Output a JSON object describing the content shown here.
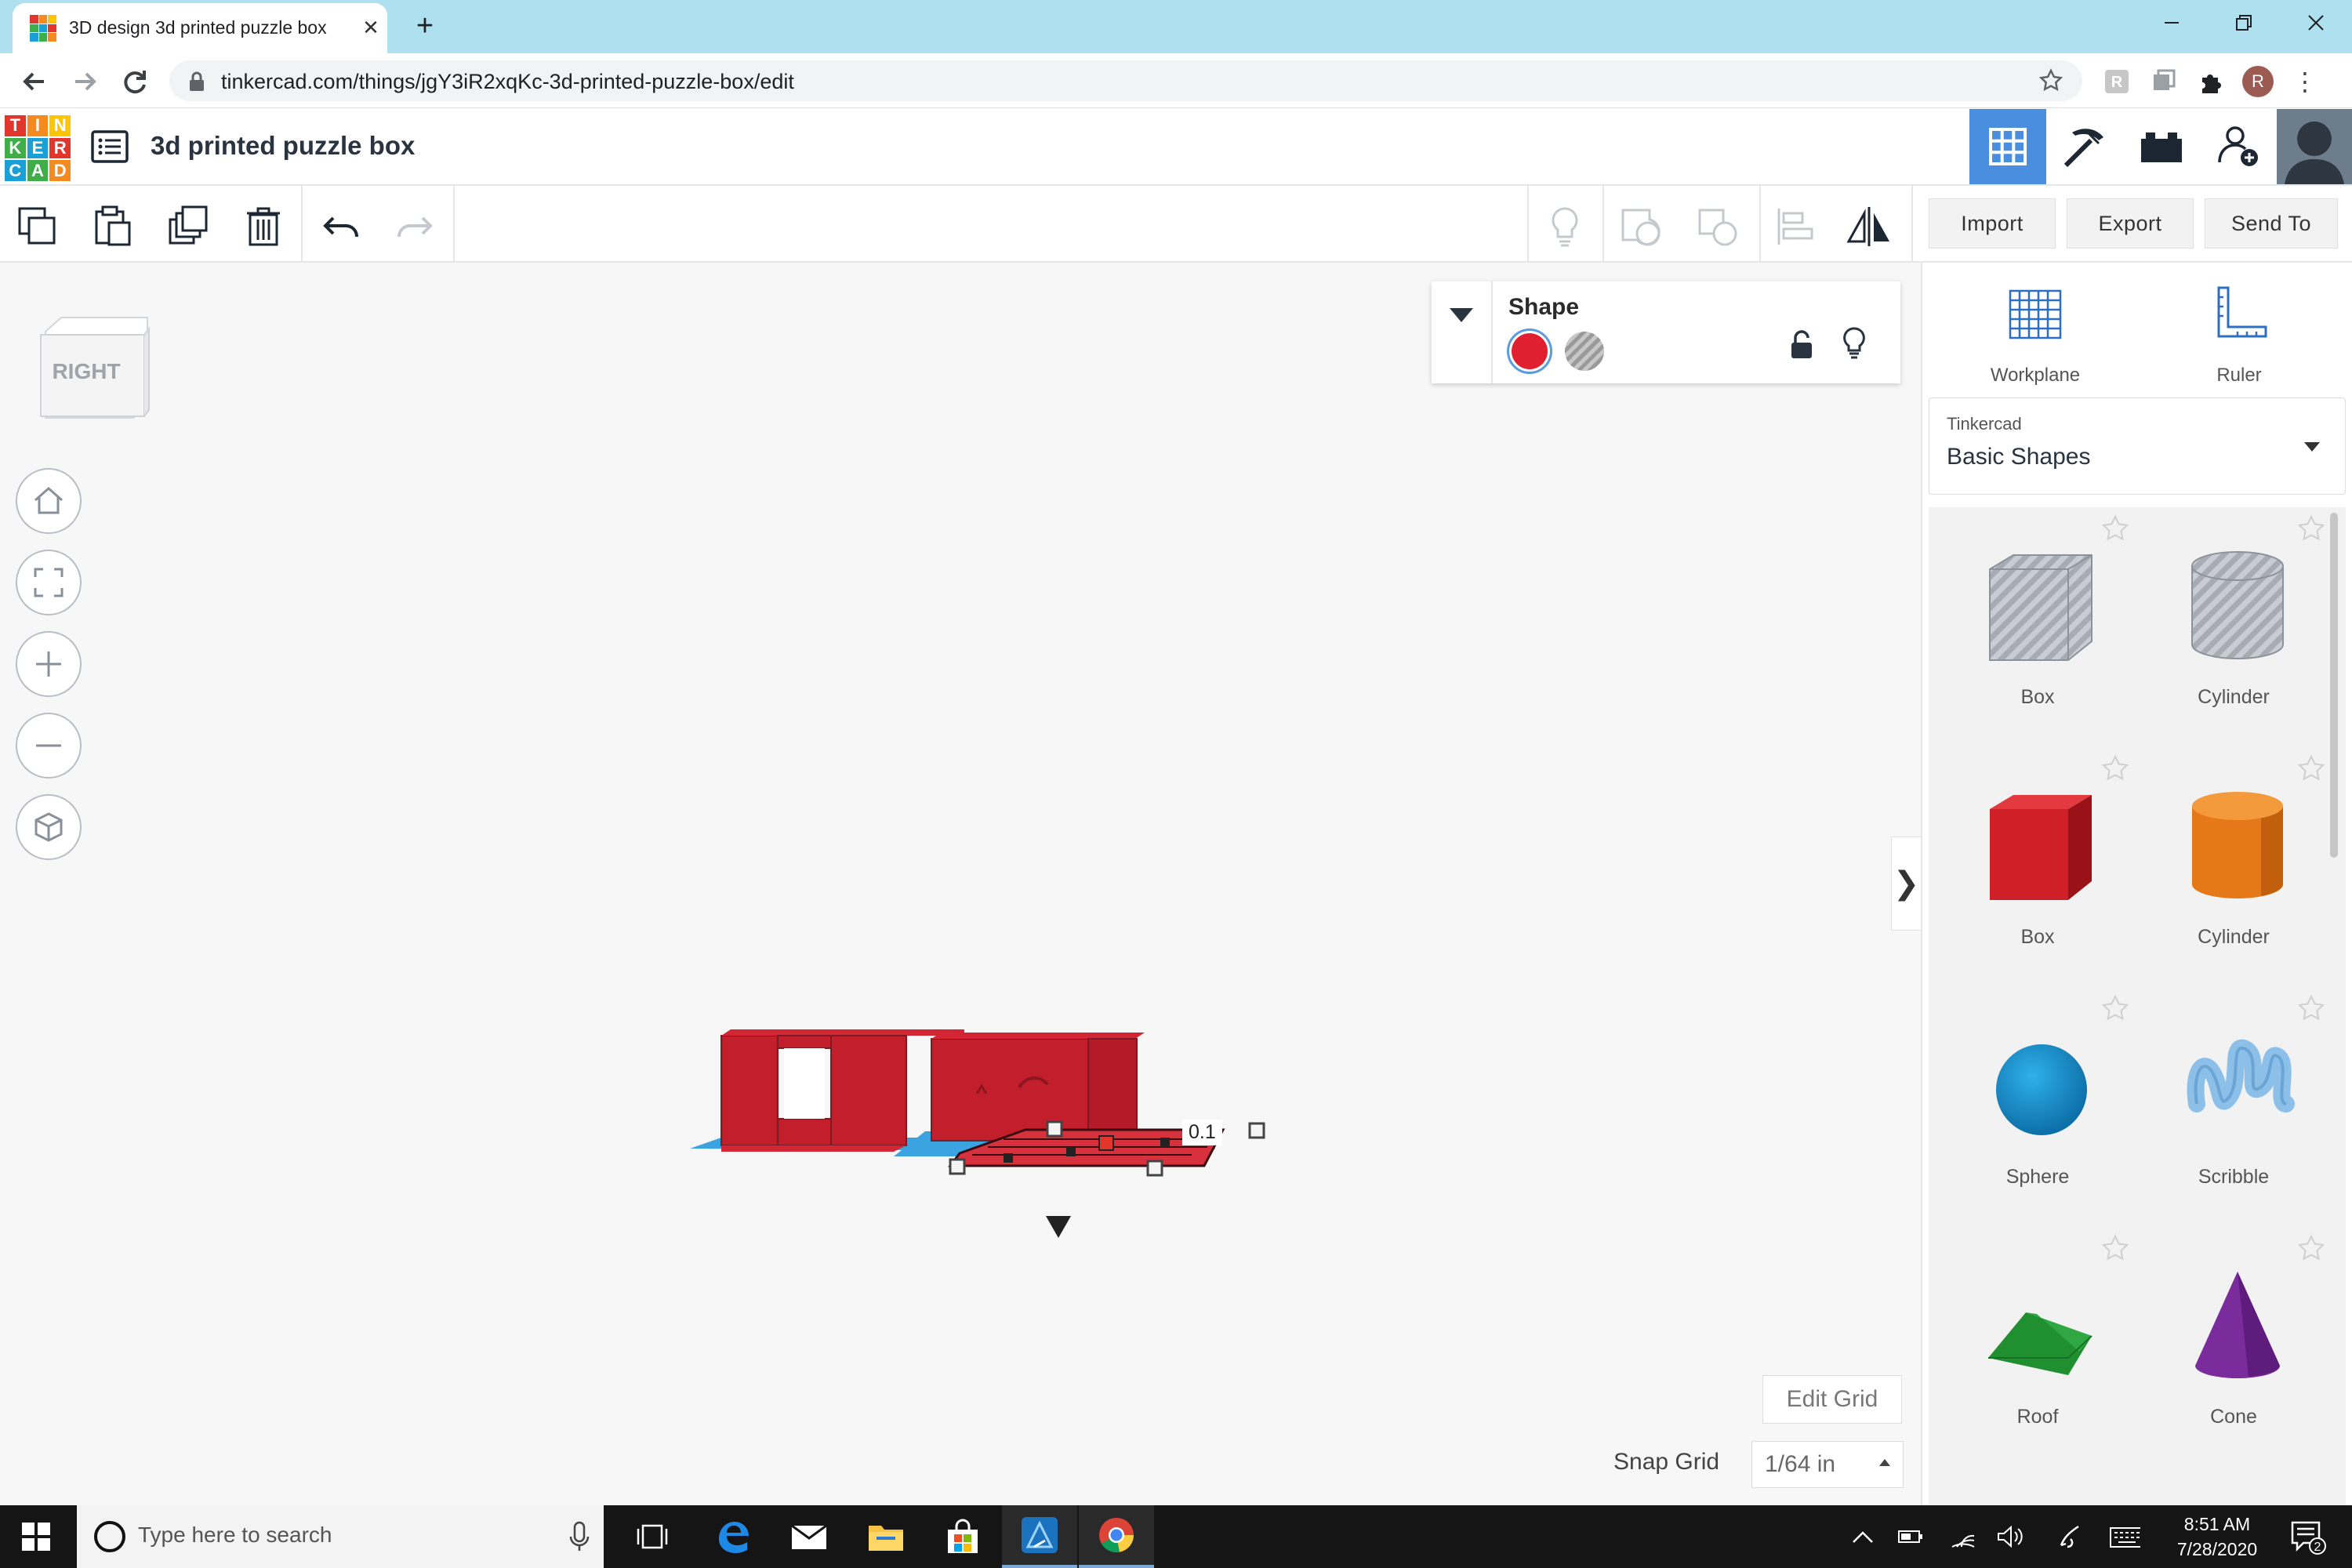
{
  "browser": {
    "tab_title": "3D design 3d printed puzzle box",
    "url": "tinkercad.com/things/jgY3iR2xqKc-3d-printed-puzzle-box/edit",
    "profile_initial": "R"
  },
  "header": {
    "logo_letters": [
      "T",
      "I",
      "N",
      "K",
      "E",
      "R",
      "C",
      "A",
      "D"
    ],
    "logo_colors": [
      "#e2352b",
      "#f58a1f",
      "#ffc500",
      "#3fae49",
      "#1aa0d6",
      "#e2352b",
      "#1aa0d6",
      "#3fae49",
      "#f58a1f"
    ],
    "design_title": "3d printed puzzle box",
    "accent_color": "#4a8fdf"
  },
  "toolbar": {
    "import_label": "Import",
    "export_label": "Export",
    "send_to_label": "Send To"
  },
  "viewcube": {
    "face_label": "RIGHT"
  },
  "shape_panel": {
    "title": "Shape",
    "solid_color": "#e0202e"
  },
  "workspace": {
    "dimension_value": "0.1",
    "edit_grid_label": "Edit Grid",
    "snap_grid_label": "Snap Grid",
    "snap_grid_value": "1/64 in"
  },
  "right_panel": {
    "workplane_label": "Workplane",
    "ruler_label": "Ruler",
    "library_provider": "Tinkercad",
    "library_name": "Basic Shapes",
    "shapes": [
      {
        "name": "Box",
        "icon": "box-hole-icon"
      },
      {
        "name": "Cylinder",
        "icon": "cylinder-hole-icon"
      },
      {
        "name": "Box",
        "icon": "box-red-icon"
      },
      {
        "name": "Cylinder",
        "icon": "cylinder-orange-icon"
      },
      {
        "name": "Sphere",
        "icon": "sphere-blue-icon"
      },
      {
        "name": "Scribble",
        "icon": "scribble-icon"
      },
      {
        "name": "Roof",
        "icon": "roof-green-icon"
      },
      {
        "name": "Cone",
        "icon": "cone-purple-icon"
      }
    ]
  },
  "taskbar": {
    "search_placeholder": "Type here to search",
    "time": "8:51 AM",
    "date": "7/28/2020",
    "notification_count": "2"
  }
}
